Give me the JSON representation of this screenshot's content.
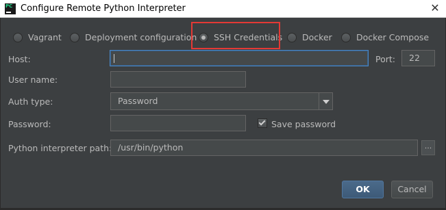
{
  "window": {
    "title": "Configure Remote Python Interpreter",
    "app_icon_text": "PC",
    "close_glyph": "✕"
  },
  "radio_options": [
    {
      "label": "Vagrant",
      "checked": false
    },
    {
      "label": "Deployment configuration",
      "checked": false
    },
    {
      "label": "SSH Credentials",
      "checked": true
    },
    {
      "label": "Docker",
      "checked": false
    },
    {
      "label": "Docker Compose",
      "checked": false
    }
  ],
  "form": {
    "host_label": "Host:",
    "host_value": "",
    "port_label": "Port:",
    "port_value": "22",
    "username_label": "User name:",
    "username_value": "",
    "auth_type_label": "Auth type:",
    "auth_type_value": "Password",
    "password_label": "Password:",
    "password_value": "",
    "save_password_label": "Save password",
    "save_password_checked": true,
    "interpreter_path_label": "Python interpreter path:",
    "interpreter_path_value": "/usr/bin/python",
    "browse_label": "..."
  },
  "buttons": {
    "ok_label": "OK",
    "cancel_label": "Cancel"
  },
  "colors": {
    "background": "#3c3f41",
    "text": "#bbbbbb",
    "highlight_box": "#e53935",
    "focus_border": "#4a88c7",
    "ok_button": "#3d5a78"
  }
}
